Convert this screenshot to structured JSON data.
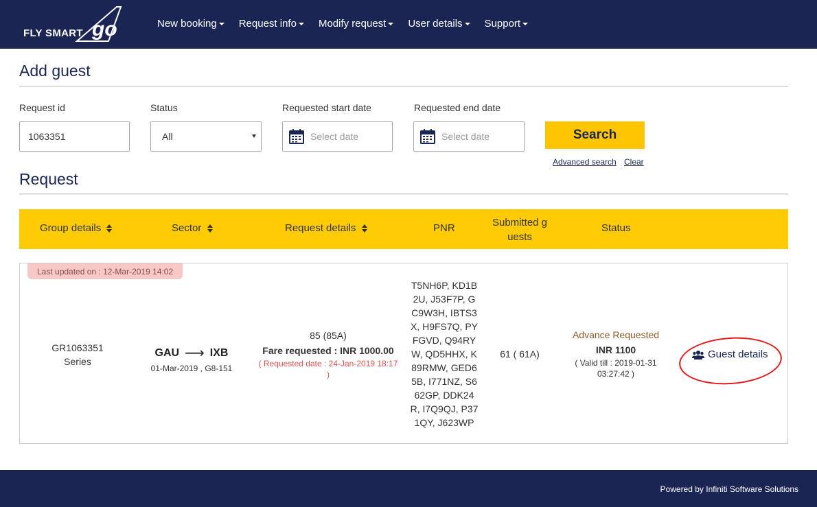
{
  "brand": {
    "text": "FLY SMART",
    "mark": "go"
  },
  "nav": [
    {
      "label": "New booking"
    },
    {
      "label": "Request info"
    },
    {
      "label": "Modify request"
    },
    {
      "label": "User details"
    },
    {
      "label": "Support"
    }
  ],
  "add_guest": {
    "title": "Add guest",
    "request_id": {
      "label": "Request id",
      "value": "1063351"
    },
    "status": {
      "label": "Status",
      "value": "All"
    },
    "start_date": {
      "label": "Requested start date",
      "placeholder": "Select date"
    },
    "end_date": {
      "label": "Requested end date",
      "placeholder": "Select date"
    },
    "search_label": "Search",
    "advanced_search": "Advanced search",
    "clear": "Clear"
  },
  "request": {
    "title": "Request",
    "columns": {
      "group": "Group details",
      "sector": "Sector",
      "details": "Request details",
      "pnr": "PNR",
      "submitted": "Submitted g uests",
      "status": "Status"
    },
    "row": {
      "last_updated": "Last updated on : 12-Mar-2019 14:02",
      "group_id": "GR1063351",
      "group_type": "Series",
      "origin": "GAU",
      "destination": "IXB",
      "flight": "01-Mar-2019 , G8-151",
      "pax": "85 (85A)",
      "fare": "Fare requested : INR 1000.00",
      "requested_date": "( Requested date : 24-Jan-2019 18:17 )",
      "pnr": "T5NH6P, KD1B2U, J53F7P, GC9W3H, IBTS3X, H9FS7Q, PYFGVD, Q94RYW, QD5HHX, K89RMW, GED65B, I771NZ, S662GP, DDK24R, I7Q9QJ, P371QY, J623WP",
      "submitted": "61 ( 61A)",
      "status": "Advance Requested",
      "amount": "INR 1100",
      "valid_till": "( Valid till : 2019-01-31 03:27:42 )",
      "guest_details": "Guest details"
    }
  },
  "footer": {
    "powered": "Powered by Infiniti Software Solutions"
  },
  "colors": {
    "navy": "#1b2553",
    "yellow": "#ffcb05",
    "annotation": "#e21a1a"
  }
}
